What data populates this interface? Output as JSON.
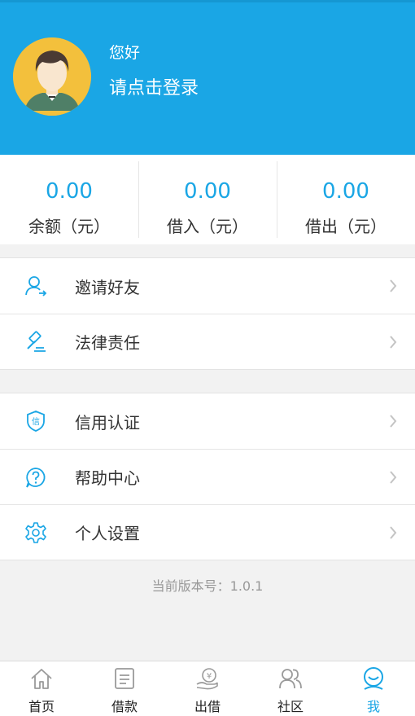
{
  "header": {
    "greeting": "您好",
    "login_prompt": "请点击登录"
  },
  "stats": [
    {
      "value": "0.00",
      "label": "余额（元）"
    },
    {
      "value": "0.00",
      "label": "借入（元）"
    },
    {
      "value": "0.00",
      "label": "借出（元）"
    }
  ],
  "menu_group_1": [
    {
      "label": "邀请好友",
      "icon": "invite-friend-icon"
    },
    {
      "label": "法律责任",
      "icon": "gavel-icon"
    }
  ],
  "menu_group_2": [
    {
      "label": "信用认证",
      "icon": "credit-shield-icon",
      "icon_text": "信"
    },
    {
      "label": "帮助中心",
      "icon": "help-icon"
    },
    {
      "label": "个人设置",
      "icon": "settings-gear-icon"
    }
  ],
  "version": "当前版本号：1.0.1",
  "tabbar": [
    {
      "label": "首页",
      "icon": "home-icon"
    },
    {
      "label": "借款",
      "icon": "borrow-icon"
    },
    {
      "label": "出借",
      "icon": "lend-icon",
      "icon_text": "¥"
    },
    {
      "label": "社区",
      "icon": "community-icon"
    },
    {
      "label": "我",
      "icon": "me-icon",
      "active": true
    }
  ],
  "colors": {
    "accent": "#1aa6e5",
    "icon_gray": "#9a9a9a"
  }
}
